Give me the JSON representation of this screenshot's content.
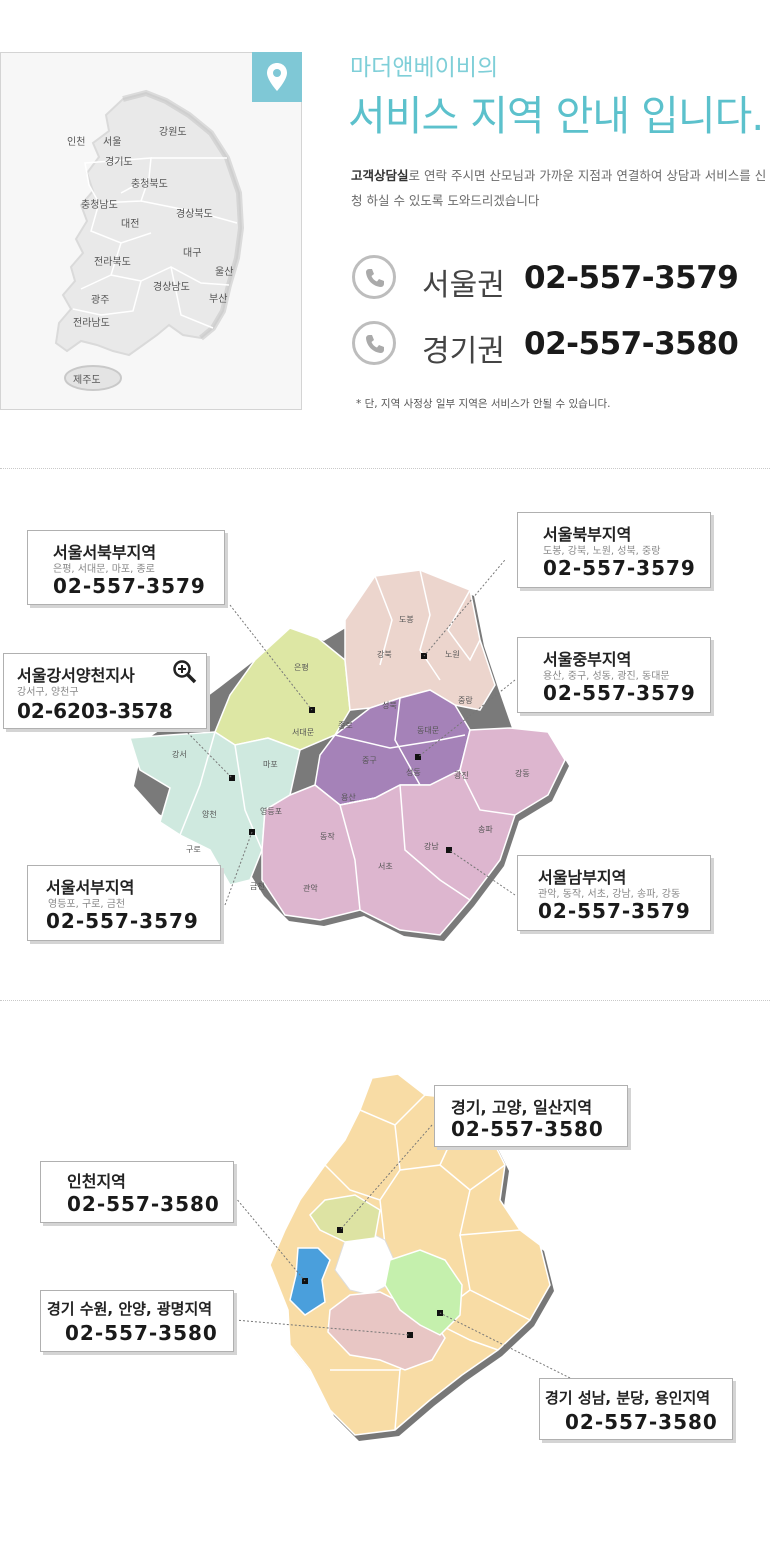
{
  "intro": {
    "subtitle": "마더앤베이비의",
    "title": "서비스 지역 안내 입니다.",
    "desc_strong": "고객상담실",
    "desc_rest": "로 연락 주시면 산모님과 가까운 지점과 연결하여 상담과 서비스를 신청 하실 수 있도록 도와드리겠습니다",
    "phones": [
      {
        "label": "서울권",
        "number": "02-557-3579"
      },
      {
        "label": "경기권",
        "number": "02-557-3580"
      }
    ],
    "note": "* 단, 지역 사정상 일부 지역은 서비스가 안될 수 있습니다.",
    "icons": {
      "pin": "location-pin-icon",
      "phone": "phone-icon"
    },
    "accent_color": "#7fc8d6"
  },
  "korea_map": {
    "regions": [
      "인천",
      "서울",
      "강원도",
      "경기도",
      "충청북도",
      "충청남도",
      "대전",
      "경상북도",
      "전라북도",
      "대구",
      "울산",
      "경상남도",
      "부산",
      "광주",
      "전라남도",
      "제주도"
    ]
  },
  "seoul_map": {
    "districts": [
      "도봉",
      "강북",
      "노원",
      "은평",
      "성북",
      "중랑",
      "종로",
      "서대문",
      "동대문",
      "강서",
      "마포",
      "중구",
      "성동",
      "광진",
      "강동",
      "양천",
      "용산",
      "영등포",
      "동작",
      "송파",
      "구로",
      "강남",
      "서초",
      "금천",
      "관악"
    ],
    "callouts": [
      {
        "title": "서울서북부지역",
        "sub": "은평, 서대문, 마포, 종로",
        "phone": "02-557-3579"
      },
      {
        "title": "서울북부지역",
        "sub": "도봉, 강북, 노원, 성북, 중랑",
        "phone": "02-557-3579"
      },
      {
        "title": "서울강서양천지사",
        "sub": "강서구, 양천구",
        "phone": "02-6203-3578"
      },
      {
        "title": "서울중부지역",
        "sub": "용산, 중구, 성동, 광진, 동대문",
        "phone": "02-557-3579"
      },
      {
        "title": "서울서부지역",
        "sub": "영등포, 구로, 금천",
        "phone": "02-557-3579"
      },
      {
        "title": "서울남부지역",
        "sub": "관악, 동작, 서초, 강남, 송파, 강동",
        "phone": "02-557-3579"
      }
    ],
    "colors": {
      "northwest": "#dde7a4",
      "north": "#ecd5cd",
      "west": "#cfe9df",
      "central": "#a582b8",
      "south": "#ddb6cf"
    }
  },
  "gyeonggi_map": {
    "callouts": [
      {
        "title": "경기, 고양, 일산지역",
        "phone": "02-557-3580"
      },
      {
        "title": "인천지역",
        "phone": "02-557-3580"
      },
      {
        "title": "경기 수원, 안양, 광명지역",
        "phone": "02-557-3580"
      },
      {
        "title": "경기 성남, 분당, 용인지역",
        "phone": "02-557-3580"
      }
    ],
    "colors": {
      "base": "#f8dca5",
      "goyang": "#dde3a3",
      "incheon": "#4a9fdc",
      "suwon": "#e8c6c4",
      "seongnam": "#c5f0ad"
    }
  }
}
